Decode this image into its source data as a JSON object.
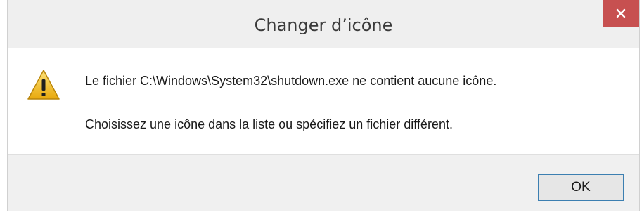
{
  "window": {
    "title": "Changer d’icône",
    "close_icon": "close-icon"
  },
  "message": {
    "icon": "warning-icon",
    "line1": "Le fichier C:\\Windows\\System32\\shutdown.exe ne contient aucune icône.",
    "line2": "Choisissez une icône dans la liste ou spécifiez un fichier différent."
  },
  "footer": {
    "ok_label": "OK"
  },
  "colors": {
    "close_button": "#c75050",
    "ok_border": "#3c7fb1",
    "warning_fill": "#f4c01c"
  }
}
